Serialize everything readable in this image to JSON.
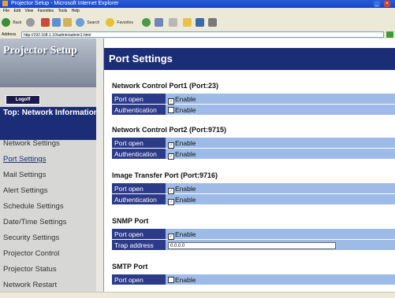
{
  "window": {
    "title": "Projector Setup - Microsoft Internet Explorer",
    "menu": [
      "File",
      "Edit",
      "View",
      "Favorites",
      "Tools",
      "Help"
    ]
  },
  "toolbar": {
    "back_label": "Back",
    "search_label": "Search",
    "favorites_label": "Favorites"
  },
  "address": {
    "label": "Address",
    "url": "http://192.168.1.10/admin/admin1.html"
  },
  "sidebar": {
    "logo_text": "Projector Setup",
    "logoff_label": "Logoff",
    "top_network_info": "Top: Network Information",
    "items": [
      {
        "label": "Network Settings"
      },
      {
        "label": "Port Settings"
      },
      {
        "label": "Mail Settings"
      },
      {
        "label": "Alert Settings"
      },
      {
        "label": "Schedule Settings"
      },
      {
        "label": "Date/Time Settings"
      },
      {
        "label": "Security Settings"
      },
      {
        "label": "Projector Control"
      },
      {
        "label": "Projector Status"
      },
      {
        "label": "Network Restart"
      }
    ],
    "active_index": 1
  },
  "main": {
    "page_title": "Port Settings",
    "sections": [
      {
        "title": "Network Control Port1 (Port:23)",
        "rows": [
          {
            "label": "Port open",
            "checked": true,
            "value": "Enable"
          },
          {
            "label": "Authentication",
            "checked": false,
            "value": "Enable"
          }
        ]
      },
      {
        "title": "Network Control Port2 (Port:9715)",
        "rows": [
          {
            "label": "Port open",
            "checked": true,
            "value": "Enable"
          },
          {
            "label": "Authentication",
            "checked": true,
            "value": "Enable"
          }
        ]
      },
      {
        "title": "Image Transfer Port (Port:9716)",
        "rows": [
          {
            "label": "Port open",
            "checked": true,
            "value": "Enable"
          },
          {
            "label": "Authentication",
            "checked": true,
            "value": "Enable"
          }
        ]
      },
      {
        "title": "SNMP Port",
        "rows": [
          {
            "label": "Port open",
            "checked": true,
            "value": "Enable"
          },
          {
            "label": "Trap address",
            "input": "0.0.0.0"
          }
        ]
      },
      {
        "title": "SMTP Port",
        "rows": [
          {
            "label": "Port open",
            "checked": false,
            "value": "Enable"
          }
        ]
      }
    ]
  },
  "colors": {
    "nav_dark": "#1c2d78",
    "row_label_bg": "#2c3a8a",
    "row_value_bg": "#9dbbe6"
  }
}
